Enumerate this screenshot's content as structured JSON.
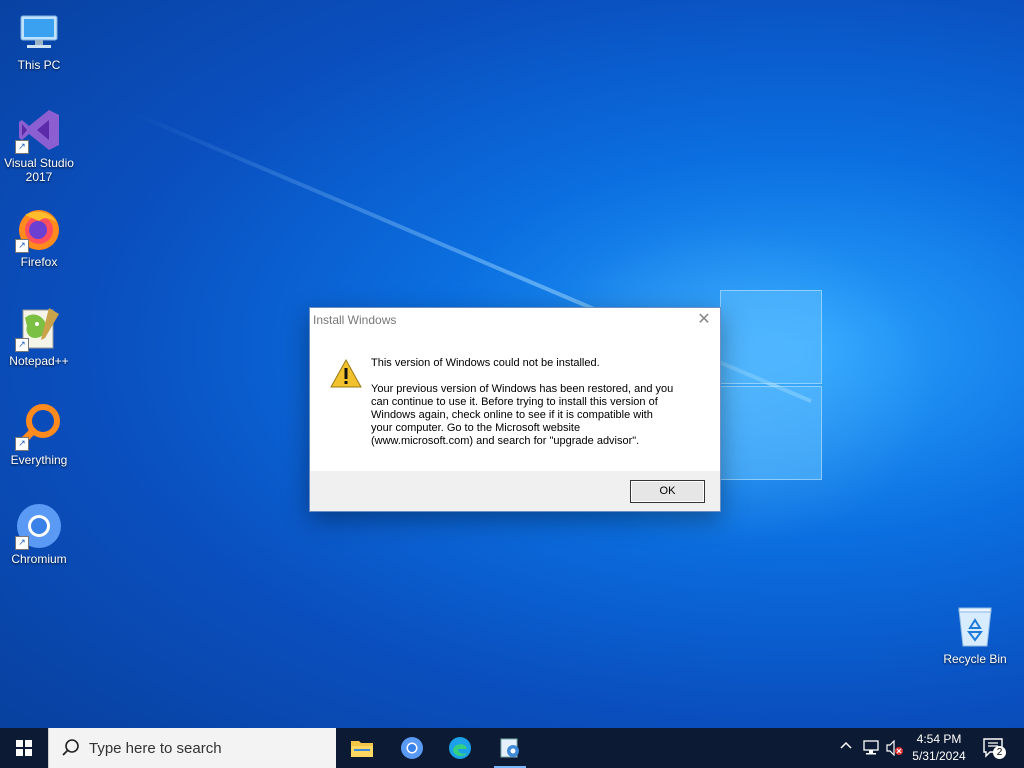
{
  "desktop": {
    "icons": [
      {
        "label": "This PC"
      },
      {
        "label": "Visual Studio 2017"
      },
      {
        "label": "Firefox"
      },
      {
        "label": "Notepad++"
      },
      {
        "label": "Everything"
      },
      {
        "label": "Chromium"
      },
      {
        "label": "Recycle Bin"
      }
    ]
  },
  "dialog": {
    "title": "Install Windows",
    "close_glyph": "✕",
    "main_message": "This version of Windows could not be installed.",
    "detail_message": "Your previous version of Windows has been restored, and you\ncan continue to use it.  Before trying to install this version of\nWindows again, check online to see if it is compatible with\nyour computer.  Go to the Microsoft website\n(www.microsoft.com) and search for \"upgrade advisor\".",
    "ok_label": "OK"
  },
  "taskbar": {
    "search_placeholder": "Type here to search",
    "time": "4:54 PM",
    "date": "5/31/2024",
    "notification_count": "2"
  },
  "colors": {
    "accent": "#0a66d8",
    "taskbar": "#0c1b33",
    "warning": "#f2c12e"
  }
}
